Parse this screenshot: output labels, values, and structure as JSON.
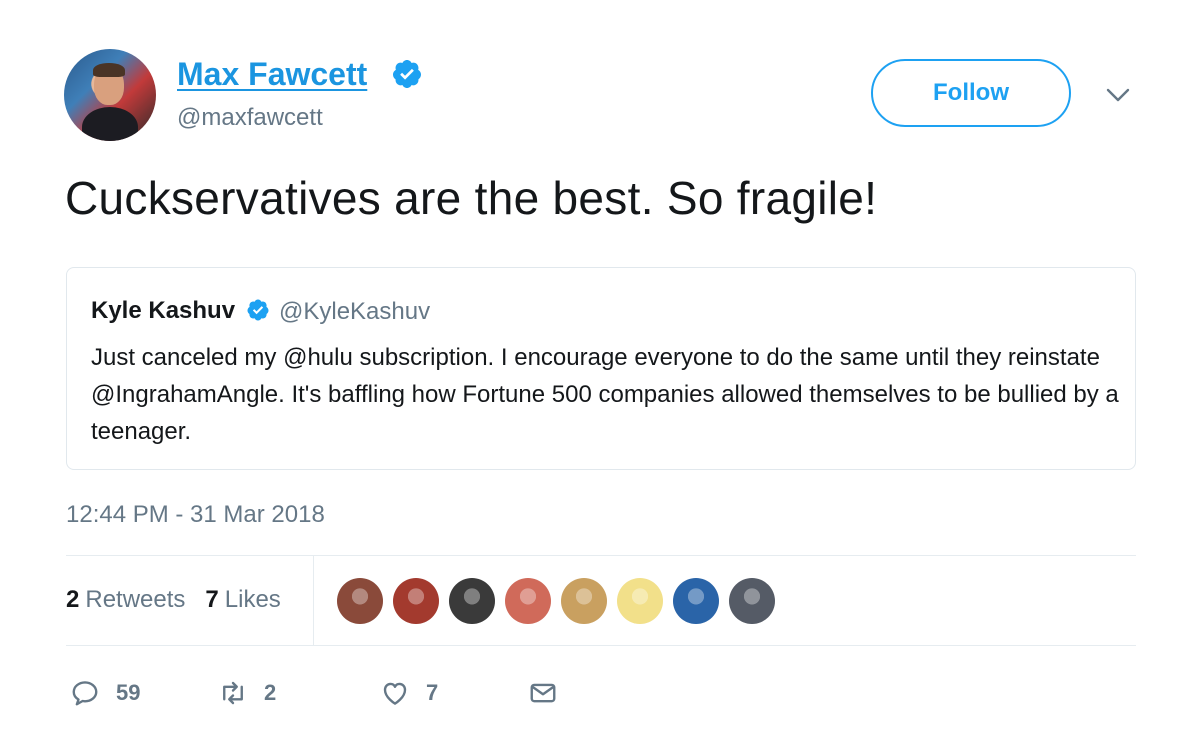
{
  "author": {
    "name": "Max Fawcett",
    "handle": "@maxfawcett",
    "verified": true,
    "verified_icon": "verified-badge-icon"
  },
  "follow_label": "Follow",
  "tweet_text": "Cuckservatives are the best. So fragile!",
  "quoted_tweet": {
    "name": "Kyle Kashuv",
    "handle": "@KyleKashuv",
    "verified": true,
    "text": "Just canceled my @hulu subscription.  I encourage everyone to do the same until they reinstate @IngrahamAngle. It's baffling how Fortune 500 companies allowed themselves to be bullied by a teenager."
  },
  "timestamp": "12:44 PM - 31 Mar 2018",
  "stats": {
    "retweets_count": "2",
    "retweets_label": "Retweets",
    "likes_count": "7",
    "likes_label": "Likes"
  },
  "liker_avatars": [
    "#8a4a3a",
    "#a33a2e",
    "#3a3a3a",
    "#d06a5a",
    "#c9a060",
    "#f2e08a",
    "#2a64a8",
    "#555b66"
  ],
  "actions": {
    "reply_count": "59",
    "retweet_count": "2",
    "like_count": "7"
  },
  "colors": {
    "accent": "#1da1f2",
    "link": "#1b95e0",
    "muted": "#657786",
    "text": "#14171a"
  }
}
